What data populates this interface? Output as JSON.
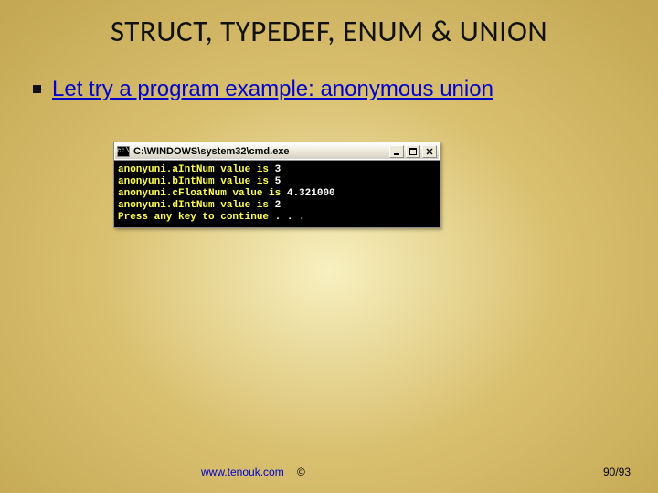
{
  "slide": {
    "title": "STRUCT, TYPEDEF, ENUM & UNION",
    "bullet_link": "Let try a program example: anonymous union"
  },
  "window": {
    "icon_text": "c:\\",
    "title": "C:\\WINDOWS\\system32\\cmd.exe",
    "lines": [
      {
        "left": "anonyuni.aIntNum value is ",
        "right": "3"
      },
      {
        "left": "anonyuni.bIntNum value is ",
        "right": "5"
      },
      {
        "left": "anonyuni.cFloatNum value is ",
        "right": "4.321000"
      },
      {
        "left": "anonyuni.dIntNum value is ",
        "right": "2"
      },
      {
        "left": "Press any key to continue ",
        "right": ". . ."
      }
    ]
  },
  "footer": {
    "link": "www.tenouk.com",
    "copy": " ©",
    "page": "90/93"
  }
}
